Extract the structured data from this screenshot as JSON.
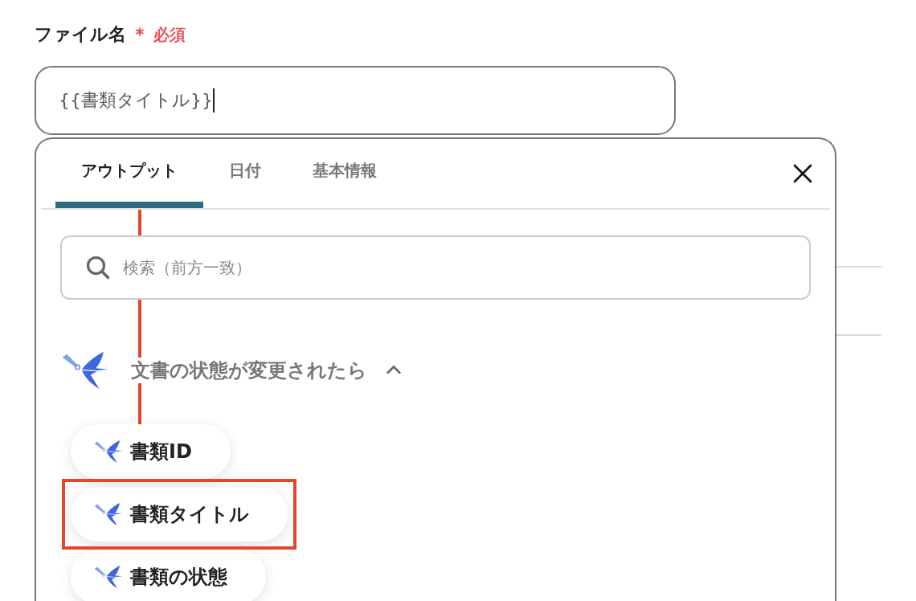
{
  "field": {
    "label": "ファイル名",
    "required_mark": "＊",
    "required_text": "必須",
    "value": "{{書類タイトル}}",
    "focused": true
  },
  "panel": {
    "tabs": [
      {
        "label": "アウトプット",
        "selected": true
      },
      {
        "label": "日付",
        "selected": false
      },
      {
        "label": "基本情報",
        "selected": false
      }
    ],
    "search": {
      "placeholder": "検索（前方一致）"
    },
    "section": {
      "title": "文書の状態が変更されたら",
      "expanded": true,
      "items": [
        {
          "label": "書類ID",
          "highlighted": false
        },
        {
          "label": "書類タイトル",
          "highlighted": true
        },
        {
          "label": "書類の状態",
          "highlighted": false
        }
      ]
    }
  }
}
